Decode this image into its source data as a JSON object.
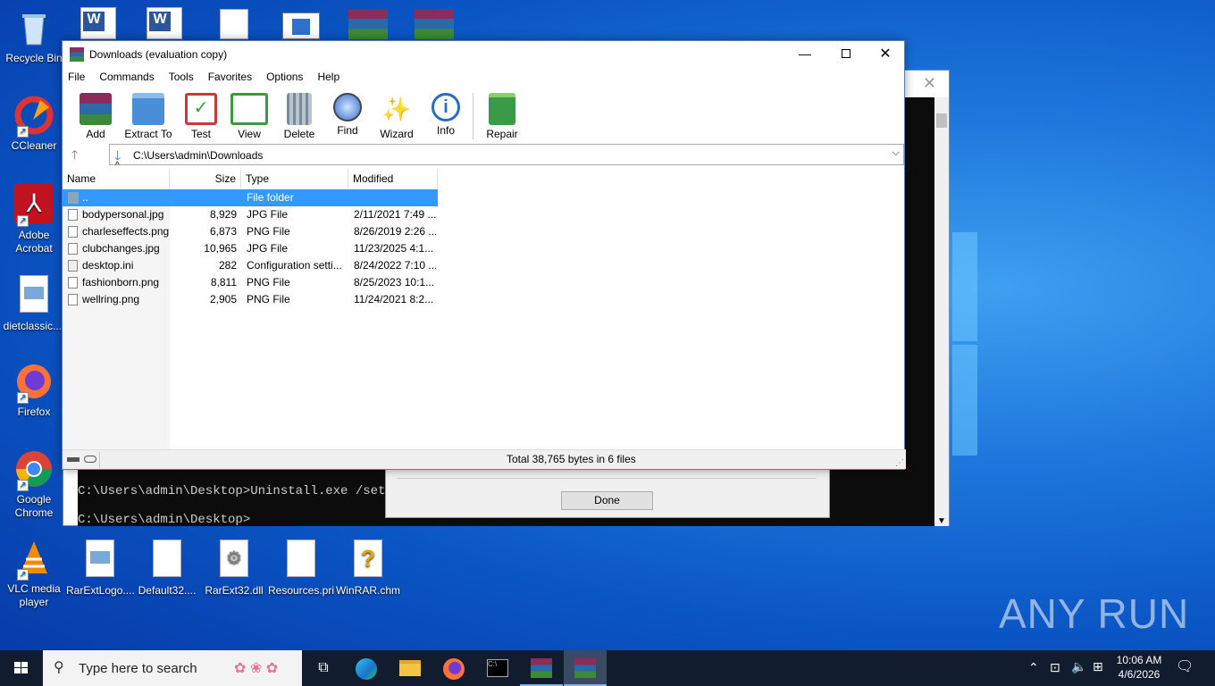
{
  "desktop": {
    "left_icons": [
      {
        "label": "Recycle Bin",
        "icon": "recycle-bin-icon"
      },
      {
        "label": "CCleaner",
        "icon": "ccleaner-icon"
      },
      {
        "label": "Adobe Acrobat",
        "icon": "acrobat-icon"
      },
      {
        "label": "dietclassic....",
        "icon": "image-file-icon"
      },
      {
        "label": "Firefox",
        "icon": "firefox-icon"
      },
      {
        "label": "Google Chrome",
        "icon": "chrome-icon"
      },
      {
        "label": "VLC media player",
        "icon": "vlc-icon"
      }
    ],
    "bottom_icons": [
      {
        "label": "RarExtLogo....",
        "icon": "image-file-icon"
      },
      {
        "label": "Default32....",
        "icon": "file-icon"
      },
      {
        "label": "RarExt32.dll",
        "icon": "dll-file-icon"
      },
      {
        "label": "Resources.pri",
        "icon": "file-icon"
      },
      {
        "label": "WinRAR.chm",
        "icon": "help-file-icon"
      }
    ],
    "logo_text": "ANY RUN"
  },
  "console": {
    "line1": "C:\\Users\\admin\\Desktop>Uninstall.exe /setup",
    "line2": "C:\\Users\\admin\\Desktop>"
  },
  "dialog": {
    "done_label": "Done"
  },
  "winrar": {
    "title": "Downloads (evaluation copy)",
    "menu": [
      "File",
      "Commands",
      "Tools",
      "Favorites",
      "Options",
      "Help"
    ],
    "toolbar": [
      {
        "label": "Add",
        "icon": "add-archive-icon",
        "color": "#c8403a"
      },
      {
        "label": "Extract To",
        "icon": "extract-folder-icon",
        "color": "#4a8ed8"
      },
      {
        "label": "Test",
        "icon": "test-checklist-icon",
        "color": "#c83a3a"
      },
      {
        "label": "View",
        "icon": "view-book-icon",
        "color": "#3c9a3c"
      },
      {
        "label": "Delete",
        "icon": "trash-icon",
        "color": "#8a9aa8"
      },
      {
        "label": "Find",
        "icon": "magnifier-icon",
        "color": "#3a6fc8"
      },
      {
        "label": "Wizard",
        "icon": "wizard-wand-icon",
        "color": "#9a6ad8"
      },
      {
        "label": "Info",
        "icon": "info-icon",
        "color": "#2a6ac8"
      },
      {
        "label": "Repair",
        "icon": "repair-kit-icon",
        "color": "#3a9a48"
      }
    ],
    "path": "C:\\Users\\admin\\Downloads",
    "columns": {
      "name": "Name",
      "size": "Size",
      "type": "Type",
      "modified": "Modified"
    },
    "files": [
      {
        "name": "..",
        "size": "",
        "type": "File folder",
        "modified": "",
        "selected": true
      },
      {
        "name": "bodypersonal.jpg",
        "size": "8,929",
        "type": "JPG File",
        "modified": "2/11/2021 7:49 ..."
      },
      {
        "name": "charleseffects.png",
        "size": "6,873",
        "type": "PNG File",
        "modified": "8/26/2019 2:26 ..."
      },
      {
        "name": "clubchanges.jpg",
        "size": "10,965",
        "type": "JPG File",
        "modified": "11/23/2025 4:1..."
      },
      {
        "name": "desktop.ini",
        "size": "282",
        "type": "Configuration setti...",
        "modified": "8/24/2022 7:10 ..."
      },
      {
        "name": "fashionborn.png",
        "size": "8,811",
        "type": "PNG File",
        "modified": "8/25/2023 10:1..."
      },
      {
        "name": "wellring.png",
        "size": "2,905",
        "type": "PNG File",
        "modified": "11/24/2021 8:2..."
      }
    ],
    "status": "Total 38,765 bytes in 6 files"
  },
  "taskbar": {
    "search_placeholder": "Type here to search",
    "time": "10:06 AM",
    "date": "4/6/2026"
  }
}
